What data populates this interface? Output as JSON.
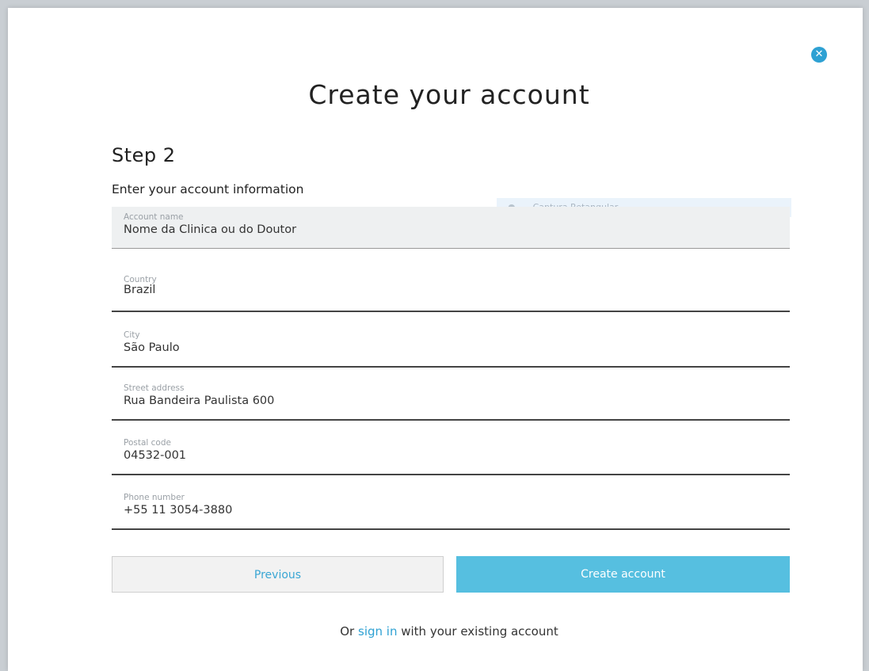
{
  "header": {
    "title": "Create your account",
    "close_icon": "close-icon"
  },
  "step": {
    "label": "Step 2",
    "subtitle": "Enter your account information"
  },
  "capture_tip": {
    "icon": "dot-icon",
    "text": "Captura Retangular"
  },
  "fields": [
    {
      "label": "Account name",
      "value": "Nome da Clinica ou do Doutor"
    },
    {
      "label": "Country",
      "value": "Brazil"
    },
    {
      "label": "City",
      "value": "São Paulo"
    },
    {
      "label": "Street address",
      "value": "Rua Bandeira Paulista 600"
    },
    {
      "label": "Postal code",
      "value": "04532-001"
    },
    {
      "label": "Phone number",
      "value": "+55 11 3054-3880"
    }
  ],
  "buttons": {
    "previous": "Previous",
    "create": "Create account"
  },
  "footer": {
    "prefix": "Or",
    "link": "sign in",
    "suffix": "with your existing account"
  },
  "colors": {
    "accent": "#2ea1d3",
    "primary_button": "#56bfe0"
  }
}
